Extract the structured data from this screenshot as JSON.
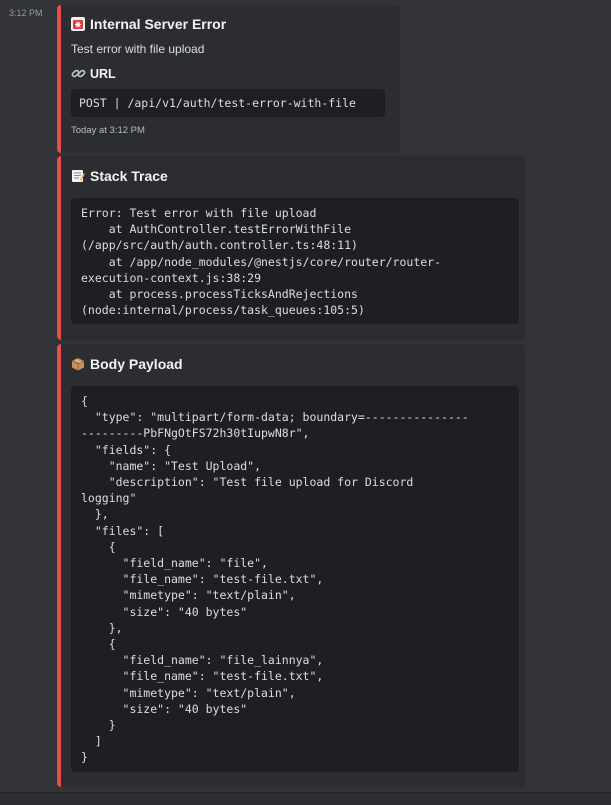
{
  "message": {
    "timestamp": "3:12 PM"
  },
  "embeds": {
    "error": {
      "title": "Internal Server Error",
      "icon": "rotating-light-icon",
      "description": "Test error with file upload",
      "field_name": "URL",
      "field_icon": "link-icon",
      "field_value": "POST | /api/v1/auth/test-error-with-file",
      "footer": "Today at 3:12 PM"
    },
    "stack": {
      "title": "Stack Trace",
      "icon": "memo-icon",
      "code": "Error: Test error with file upload\n    at AuthController.testErrorWithFile\n(/app/src/auth/auth.controller.ts:48:11)\n    at /app/node_modules/@nestjs/core/router/router-\nexecution-context.js:38:29\n    at process.processTicksAndRejections\n(node:internal/process/task_queues:105:5)"
    },
    "body": {
      "title": "Body Payload",
      "icon": "package-icon",
      "code": "{\n  \"type\": \"multipart/form-data; boundary=---------------\n---------PbFNgOtFS72h30tIupwN8r\",\n  \"fields\": {\n    \"name\": \"Test Upload\",\n    \"description\": \"Test file upload for Discord\nlogging\"\n  },\n  \"files\": [\n    {\n      \"field_name\": \"file\",\n      \"file_name\": \"test-file.txt\",\n      \"mimetype\": \"text/plain\",\n      \"size\": \"40 bytes\"\n    },\n    {\n      \"field_name\": \"file_lainnya\",\n      \"file_name\": \"test-file.txt\",\n      \"mimetype\": \"text/plain\",\n      \"size\": \"40 bytes\"\n    }\n  ]\n}"
    }
  },
  "colors": {
    "background": "#313338",
    "embed_background": "#2b2d31",
    "embed_accent": "#e74c4c",
    "code_background": "#1e1f22"
  }
}
